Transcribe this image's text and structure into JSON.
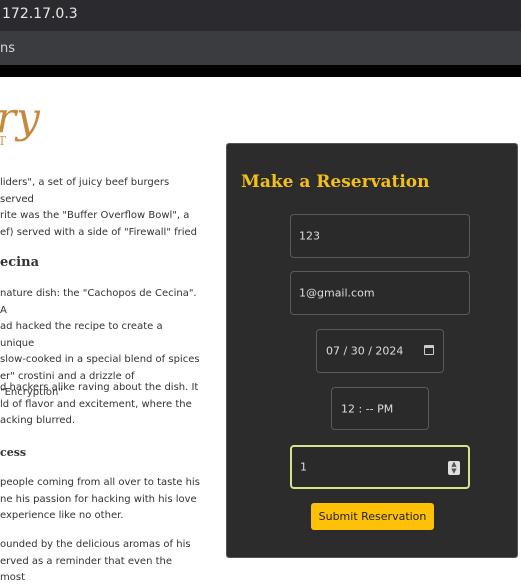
{
  "browser": {
    "address": "172.17.0.3",
    "tab_fragment": "ns"
  },
  "logo": {
    "main": "ry",
    "sub": "T"
  },
  "story": {
    "p1": [
      "liders\", a set of juicy beef burgers served",
      "rite was the \"Buffer Overflow Bowl\", a",
      "ef) served with a side of \"Firewall\" fried"
    ],
    "heading1": "ecina",
    "p2": [
      "nature dish: the \"Cachopos de Cecina\". A",
      "ad hacked the recipe to create a unique",
      "slow-cooked in a special blend of spices",
      "er\" crostini and a drizzle of \"Encryption\""
    ],
    "p3": [
      "d hackers alike raving about the dish. It",
      "ld of flavor and excitement, where the",
      "acking blurred."
    ],
    "heading2": "cess",
    "p4": [
      "people coming from all over to taste his",
      "ne his passion for hacking with his love",
      "experience like no other."
    ],
    "p5": [
      "ounded by the delicious aromas of his",
      "erved as a reminder that even the most"
    ]
  },
  "reservation": {
    "title": "Make a Reservation",
    "name_value": "123",
    "email_value": "1@gmail.com",
    "date_value": "07 / 30 / 2024",
    "time_value": "12 : --  PM",
    "guests_value": "1",
    "submit_label": "Submit Reservation"
  },
  "colors": {
    "accent": "#f3c019",
    "button": "#ffc107",
    "panel": "#2c2c2c"
  }
}
